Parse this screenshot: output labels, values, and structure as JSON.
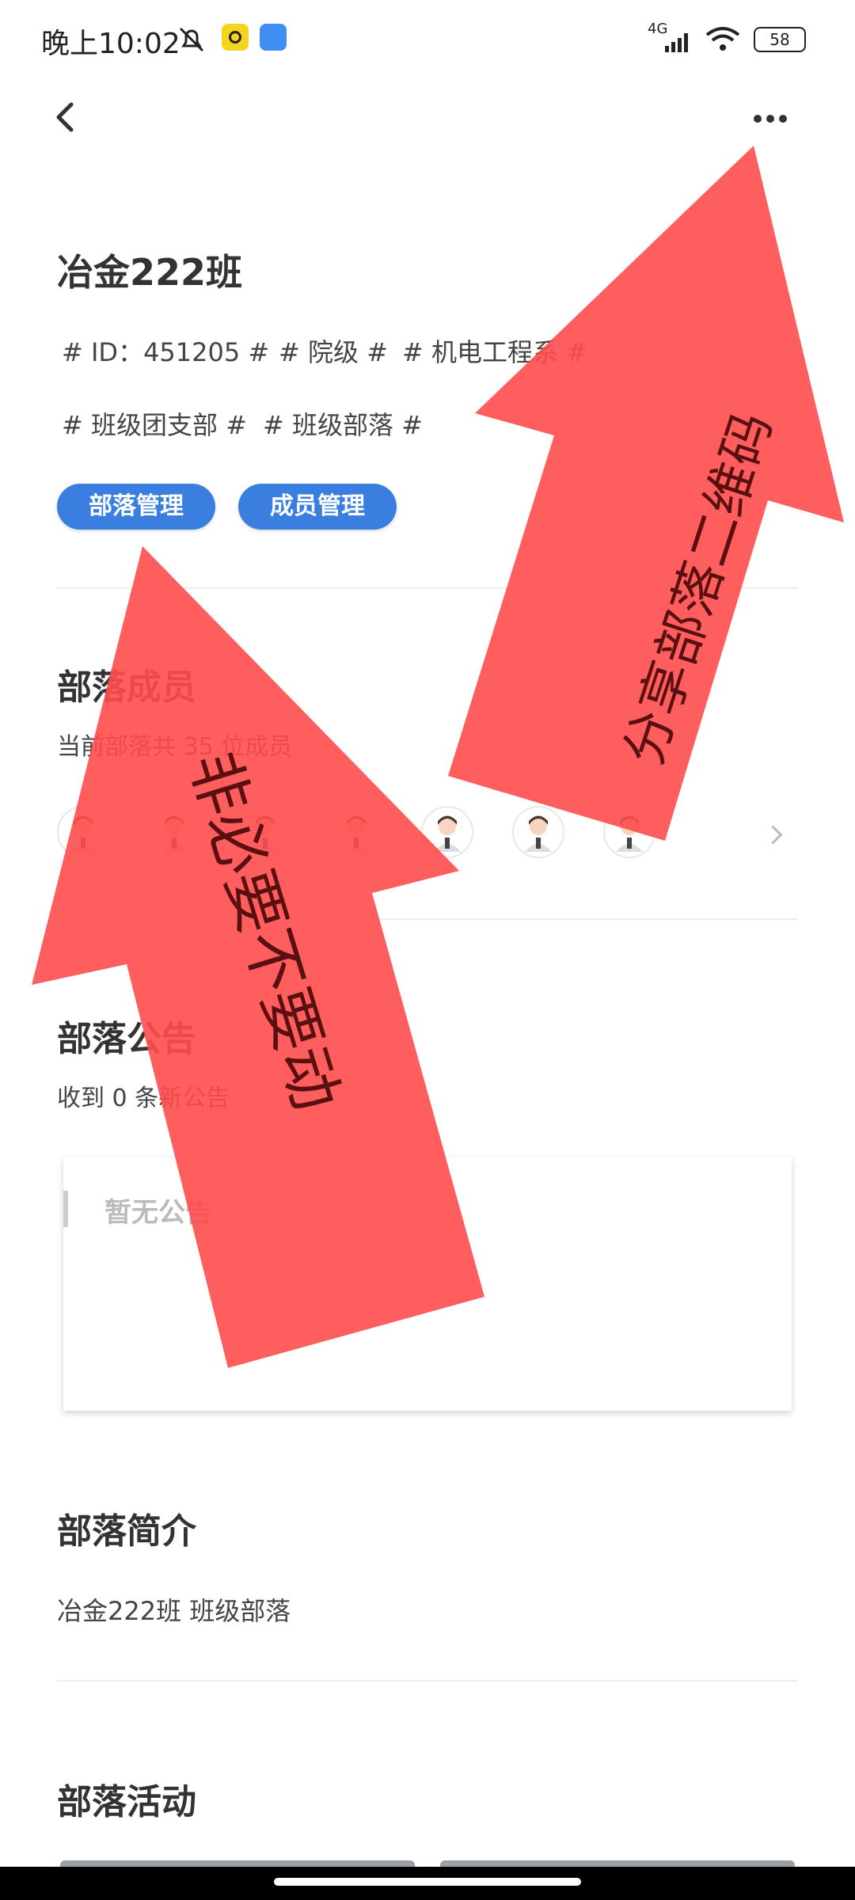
{
  "status_bar": {
    "time": "晚上10:02",
    "network": "4G",
    "battery": "58"
  },
  "nav": {
    "back": "back-icon",
    "more": "more-icon"
  },
  "tribe": {
    "name": "冶金222班",
    "tags_row1": [
      "# ID：451205 #",
      "# 院级 #",
      "# 机电工程系 #"
    ],
    "tags_row2": [
      "# 班级团支部 #",
      "# 班级部落 #"
    ],
    "buttons": {
      "manage": "部落管理",
      "members": "成员管理"
    }
  },
  "members": {
    "title": "部落成员",
    "count_text": "当前部落共 35 位成员",
    "avatar_count": 7
  },
  "announcements": {
    "title": "部落公告",
    "count_text": "收到 0 条新公告",
    "empty_text": "暂无公告"
  },
  "intro": {
    "title": "部落简介",
    "text": "冶金222班 班级部落"
  },
  "activity": {
    "title": "部落活动"
  },
  "annotations": {
    "arrow1": "分享部落二维码",
    "arrow2": "非必要不要动"
  },
  "colors": {
    "accent": "#3a7fe0",
    "arrow": "#ff5a5a"
  }
}
